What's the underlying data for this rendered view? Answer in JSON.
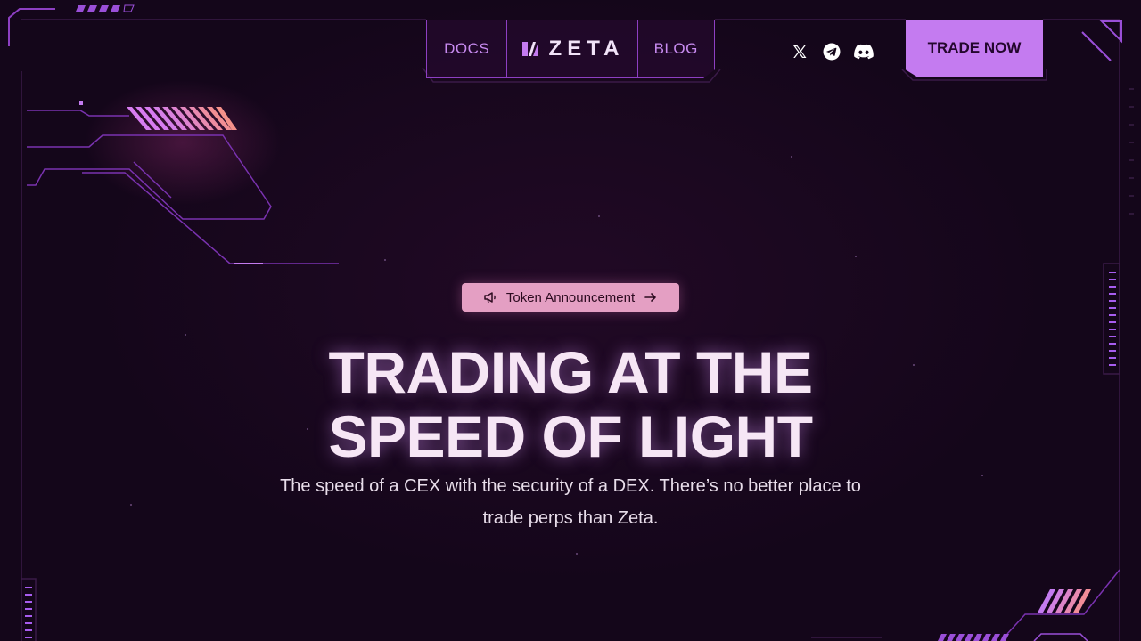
{
  "nav": {
    "docs_label": "DOCS",
    "logo_text": "ZETA",
    "blog_label": "BLOG"
  },
  "socials": [
    {
      "icon": "x-icon"
    },
    {
      "icon": "telegram-icon"
    },
    {
      "icon": "discord-icon"
    }
  ],
  "cta": {
    "trade_label": "TRADE NOW"
  },
  "announcement": {
    "label": "Token Announcement",
    "icon": "megaphone-icon",
    "arrow_icon": "arrow-right-icon"
  },
  "hero": {
    "headline_line1": "TRADING AT THE",
    "headline_line2": "SPEED OF LIGHT",
    "subtitle": "The speed of a CEX with the security of a DEX. There’s no better place to trade perps than Zeta."
  },
  "colors": {
    "background": "#14061a",
    "accent": "#c47bf0",
    "badge": "#e49fc3",
    "frame": "#8d3fc2"
  }
}
